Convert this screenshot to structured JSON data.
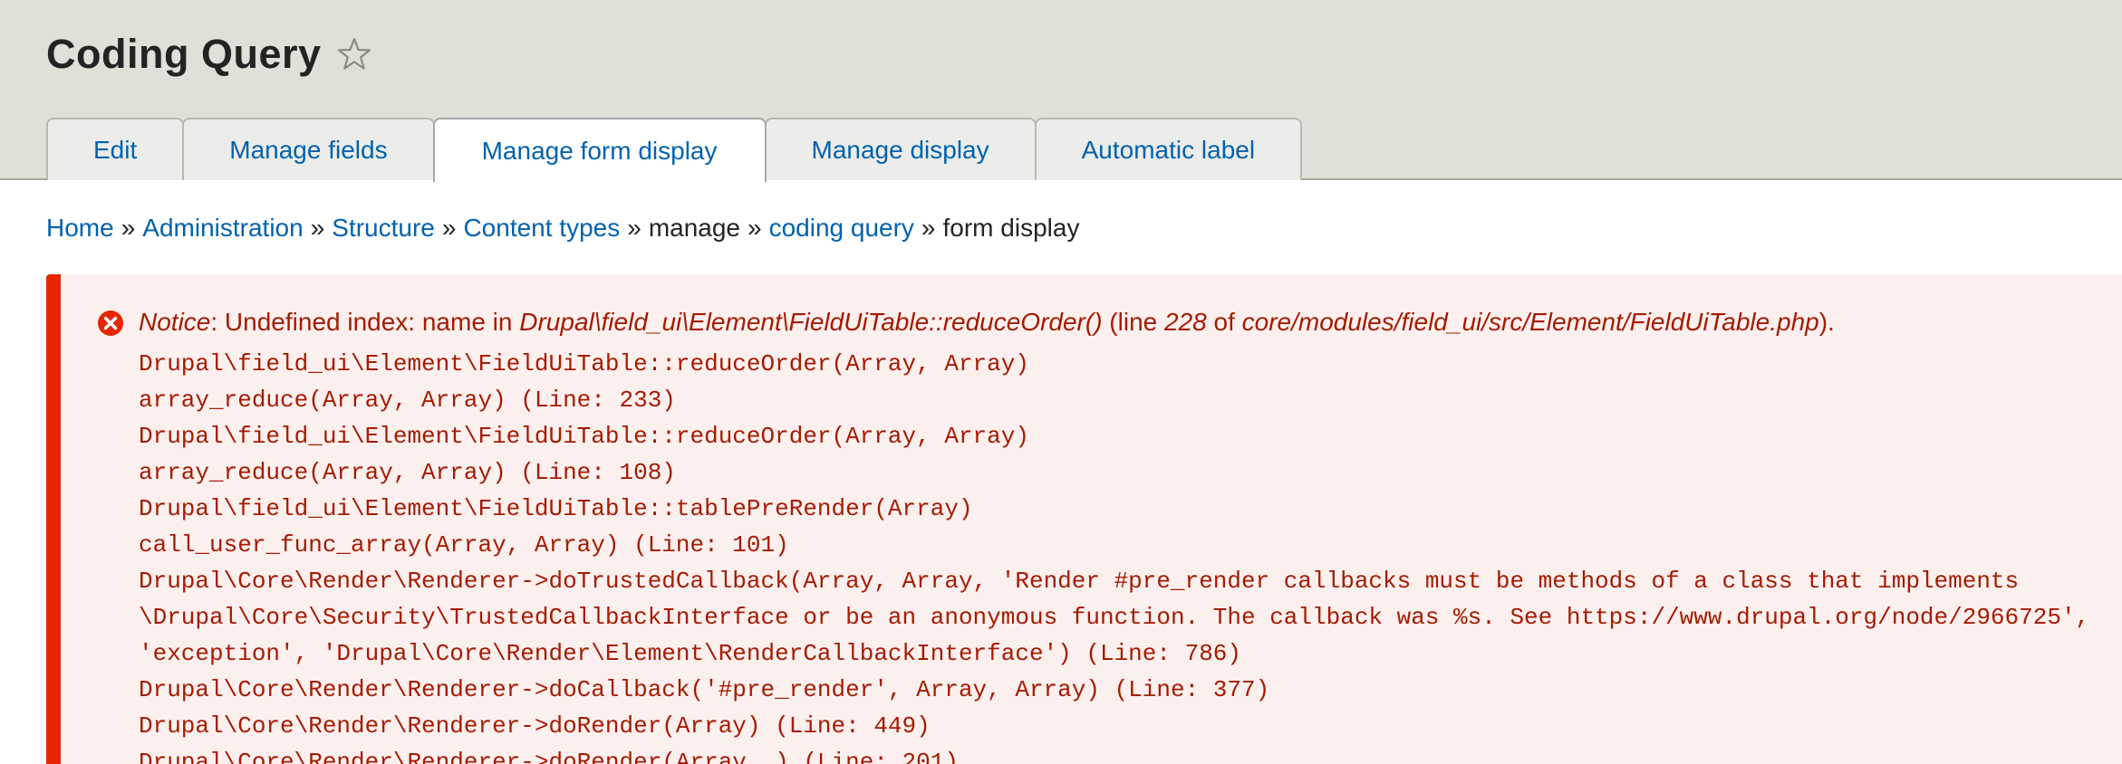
{
  "header": {
    "title": "Coding Query",
    "star_icon": "star-outline-icon"
  },
  "tabs": [
    {
      "label": "Edit",
      "active": false
    },
    {
      "label": "Manage fields",
      "active": false
    },
    {
      "label": "Manage form display",
      "active": true
    },
    {
      "label": "Manage display",
      "active": false
    },
    {
      "label": "Automatic label",
      "active": false
    }
  ],
  "breadcrumb": {
    "items": [
      "Home",
      "Administration",
      "Structure",
      "Content types",
      "manage",
      "coding query",
      "form display"
    ],
    "separator": "»"
  },
  "message": {
    "type": "error",
    "icon": "error-x-circle-icon",
    "notice_label": "Notice",
    "notice_text_1": ": Undefined index: name in ",
    "notice_function": "Drupal\\field_ui\\Element\\FieldUiTable::reduceOrder()",
    "notice_text_2": " (line ",
    "notice_line": "228",
    "notice_text_3": " of ",
    "notice_file": "core/modules/field_ui/src/Element/FieldUiTable.php",
    "notice_text_4": ").",
    "trace": [
      "Drupal\\field_ui\\Element\\FieldUiTable::reduceOrder(Array, Array)",
      "array_reduce(Array, Array) (Line: 233)",
      "Drupal\\field_ui\\Element\\FieldUiTable::reduceOrder(Array, Array)",
      "array_reduce(Array, Array) (Line: 108)",
      "Drupal\\field_ui\\Element\\FieldUiTable::tablePreRender(Array)",
      "call_user_func_array(Array, Array) (Line: 101)",
      "Drupal\\Core\\Render\\Renderer->doTrustedCallback(Array, Array, 'Render #pre_render callbacks must be methods of a class that implements",
      "\\Drupal\\Core\\Security\\TrustedCallbackInterface or be an anonymous function. The callback was %s. See https://www.drupal.org/node/2966725',",
      "'exception', 'Drupal\\Core\\Render\\Element\\RenderCallbackInterface') (Line: 786)",
      "Drupal\\Core\\Render\\Renderer->doCallback('#pre_render', Array, Array) (Line: 377)",
      "Drupal\\Core\\Render\\Renderer->doRender(Array) (Line: 449)",
      "Drupal\\Core\\Render\\Renderer->doRender(Array, ) (Line: 201)"
    ]
  },
  "colors": {
    "link": "#0062ae",
    "error_border": "#e62600",
    "error_text": "#a51b00",
    "error_bg": "#fcf0ef",
    "header_bg": "#e0e0d8"
  }
}
